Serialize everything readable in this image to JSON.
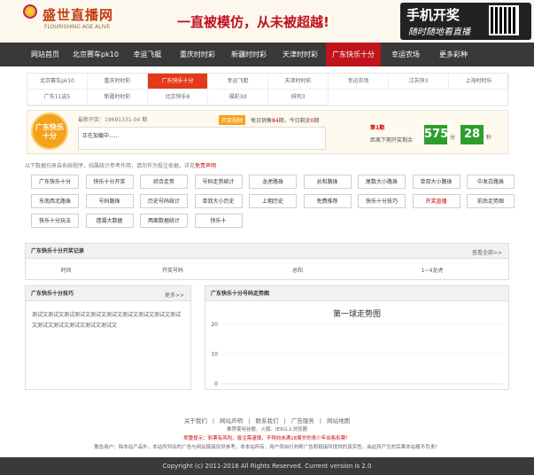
{
  "header": {
    "logo_text": "盛世直播网",
    "logo_sub": "FLOURISHING AGE ALIVE",
    "slogan": "一直被模仿，从未被超越!",
    "mobile_t1": "手机开奖",
    "mobile_t2": "随时随地看直播"
  },
  "nav": {
    "items": [
      {
        "label": "网站首页",
        "w": 52
      },
      {
        "label": "北京赛车pk10",
        "w": 62
      },
      {
        "label": "幸运飞艇",
        "w": 55
      },
      {
        "label": "重庆时时彩",
        "w": 58
      },
      {
        "label": "新疆时时彩",
        "w": 58
      },
      {
        "label": "天津时时彩",
        "w": 58
      },
      {
        "label": "广东快乐十分",
        "w": 62
      },
      {
        "label": "幸运农场",
        "w": 56
      },
      {
        "label": "更多彩种",
        "w": 52
      }
    ]
  },
  "subnav": {
    "row1": [
      "北京赛车pk10",
      "重庆时时彩",
      "广东快乐十分",
      "幸运飞艇",
      "天津时时彩",
      "幸运农场",
      "江苏快3",
      "上海时时乐"
    ],
    "row2": [
      "广东11选5",
      "新疆时时彩",
      "北京快乐8",
      "福彩3d",
      "排列3"
    ]
  },
  "info": {
    "badge": "广东快乐十分",
    "issue": "最新开奖：19691331-04 期",
    "draw_btn": "开奖视频",
    "draw_note_pre": "每日销售",
    "draw_note_num": "84",
    "draw_note_mid": "期，今日剩余",
    "draw_note_num2": "0",
    "draw_note_post": "期",
    "loading": "正在加载中......",
    "next_issue": "第1期",
    "next_label": "距离下期开奖剩余",
    "min": "575",
    "min_unit": "分",
    "sec": "28",
    "sec_unit": "秒"
  },
  "tip": {
    "text": "以下数据均来自系统程序，纯属统计参考作用，请勿作为投注依据，详见",
    "link": "免责声明"
  },
  "tools": [
    [
      "广东快乐十分",
      "快乐十分开奖",
      "综合走势",
      "号码走势统计",
      "龙虎路珠",
      "总和路珠",
      "尾数大小路珠",
      "单双大小路珠",
      "中发白路珠"
    ],
    [
      "东南西北路珠",
      "号码路珠",
      "历史号码统计",
      "单双大小历史",
      "上期历史",
      "免费推荐",
      "快乐十分技巧",
      "开奖直播",
      "前后走势图"
    ],
    [
      "快乐十分玩法",
      "遗漏大数据",
      "两面数据统计",
      "快乐十"
    ]
  ],
  "records": {
    "title": "广东快乐十分开奖记录",
    "more": "查看全部>>",
    "cols": [
      "时间",
      "开奖号码",
      "总和",
      "1~4龙虎"
    ]
  },
  "hot": {
    "title": "广东快乐十分技巧",
    "more": "更多>>",
    "text": "测试文测试文测试测试文测试文测试文测试文测试文测试文测试文测试文测试文测试文测试文测试文"
  },
  "trend": {
    "title": "广东快乐十分号码走势图"
  },
  "chart_data": {
    "type": "line",
    "title": "第一球走势图",
    "x": [],
    "series": [],
    "yticks": [
      20,
      10,
      0
    ],
    "ylim": [
      0,
      20
    ],
    "grid": true
  },
  "footer": {
    "links": [
      "关于我们",
      "网站声明",
      "联系我们",
      "广告服务",
      "网站地图"
    ],
    "note1": "推荐使用谷歌、火狐、IE9以上浏览器",
    "note2": "郑重提示：彩票有风险，投注需谨慎，不得向未满18周岁的青少年出售彩票！",
    "note3": "敬告用户：除本站产品外，本站所列出的广告与网站链接仅供参考，非本站所有，用户须自行判断广告和链接所提供的真实性，由此所产生的后果本站概不负责！",
    "copyright": "Copyright (c) 2011-2016 All Rights Reserved. Current version is 2.0"
  },
  "colors": {
    "accent": "#c0141a",
    "nav_bg": "#393939",
    "orange": "#f5a21b",
    "green": "#2e9e2e"
  }
}
